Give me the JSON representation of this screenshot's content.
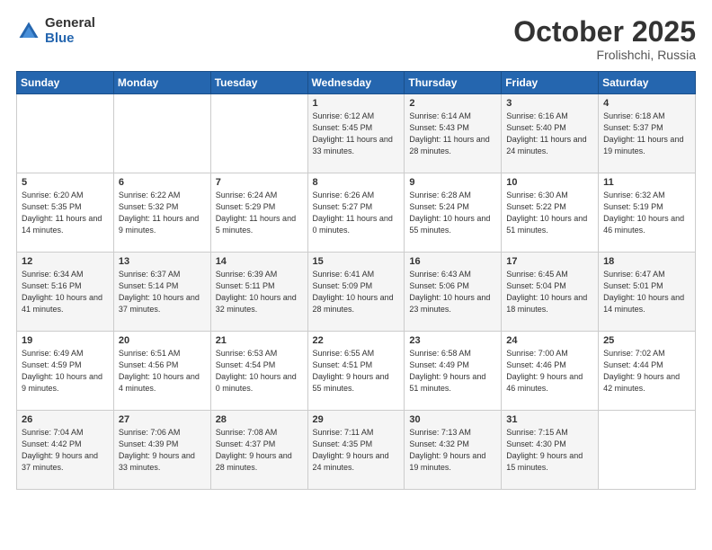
{
  "logo": {
    "general": "General",
    "blue": "Blue"
  },
  "header": {
    "month": "October 2025",
    "location": "Frolishchi, Russia"
  },
  "weekdays": [
    "Sunday",
    "Monday",
    "Tuesday",
    "Wednesday",
    "Thursday",
    "Friday",
    "Saturday"
  ],
  "weeks": [
    [
      {
        "day": "",
        "sunrise": "",
        "sunset": "",
        "daylight": ""
      },
      {
        "day": "",
        "sunrise": "",
        "sunset": "",
        "daylight": ""
      },
      {
        "day": "",
        "sunrise": "",
        "sunset": "",
        "daylight": ""
      },
      {
        "day": "1",
        "sunrise": "Sunrise: 6:12 AM",
        "sunset": "Sunset: 5:45 PM",
        "daylight": "Daylight: 11 hours and 33 minutes."
      },
      {
        "day": "2",
        "sunrise": "Sunrise: 6:14 AM",
        "sunset": "Sunset: 5:43 PM",
        "daylight": "Daylight: 11 hours and 28 minutes."
      },
      {
        "day": "3",
        "sunrise": "Sunrise: 6:16 AM",
        "sunset": "Sunset: 5:40 PM",
        "daylight": "Daylight: 11 hours and 24 minutes."
      },
      {
        "day": "4",
        "sunrise": "Sunrise: 6:18 AM",
        "sunset": "Sunset: 5:37 PM",
        "daylight": "Daylight: 11 hours and 19 minutes."
      }
    ],
    [
      {
        "day": "5",
        "sunrise": "Sunrise: 6:20 AM",
        "sunset": "Sunset: 5:35 PM",
        "daylight": "Daylight: 11 hours and 14 minutes."
      },
      {
        "day": "6",
        "sunrise": "Sunrise: 6:22 AM",
        "sunset": "Sunset: 5:32 PM",
        "daylight": "Daylight: 11 hours and 9 minutes."
      },
      {
        "day": "7",
        "sunrise": "Sunrise: 6:24 AM",
        "sunset": "Sunset: 5:29 PM",
        "daylight": "Daylight: 11 hours and 5 minutes."
      },
      {
        "day": "8",
        "sunrise": "Sunrise: 6:26 AM",
        "sunset": "Sunset: 5:27 PM",
        "daylight": "Daylight: 11 hours and 0 minutes."
      },
      {
        "day": "9",
        "sunrise": "Sunrise: 6:28 AM",
        "sunset": "Sunset: 5:24 PM",
        "daylight": "Daylight: 10 hours and 55 minutes."
      },
      {
        "day": "10",
        "sunrise": "Sunrise: 6:30 AM",
        "sunset": "Sunset: 5:22 PM",
        "daylight": "Daylight: 10 hours and 51 minutes."
      },
      {
        "day": "11",
        "sunrise": "Sunrise: 6:32 AM",
        "sunset": "Sunset: 5:19 PM",
        "daylight": "Daylight: 10 hours and 46 minutes."
      }
    ],
    [
      {
        "day": "12",
        "sunrise": "Sunrise: 6:34 AM",
        "sunset": "Sunset: 5:16 PM",
        "daylight": "Daylight: 10 hours and 41 minutes."
      },
      {
        "day": "13",
        "sunrise": "Sunrise: 6:37 AM",
        "sunset": "Sunset: 5:14 PM",
        "daylight": "Daylight: 10 hours and 37 minutes."
      },
      {
        "day": "14",
        "sunrise": "Sunrise: 6:39 AM",
        "sunset": "Sunset: 5:11 PM",
        "daylight": "Daylight: 10 hours and 32 minutes."
      },
      {
        "day": "15",
        "sunrise": "Sunrise: 6:41 AM",
        "sunset": "Sunset: 5:09 PM",
        "daylight": "Daylight: 10 hours and 28 minutes."
      },
      {
        "day": "16",
        "sunrise": "Sunrise: 6:43 AM",
        "sunset": "Sunset: 5:06 PM",
        "daylight": "Daylight: 10 hours and 23 minutes."
      },
      {
        "day": "17",
        "sunrise": "Sunrise: 6:45 AM",
        "sunset": "Sunset: 5:04 PM",
        "daylight": "Daylight: 10 hours and 18 minutes."
      },
      {
        "day": "18",
        "sunrise": "Sunrise: 6:47 AM",
        "sunset": "Sunset: 5:01 PM",
        "daylight": "Daylight: 10 hours and 14 minutes."
      }
    ],
    [
      {
        "day": "19",
        "sunrise": "Sunrise: 6:49 AM",
        "sunset": "Sunset: 4:59 PM",
        "daylight": "Daylight: 10 hours and 9 minutes."
      },
      {
        "day": "20",
        "sunrise": "Sunrise: 6:51 AM",
        "sunset": "Sunset: 4:56 PM",
        "daylight": "Daylight: 10 hours and 4 minutes."
      },
      {
        "day": "21",
        "sunrise": "Sunrise: 6:53 AM",
        "sunset": "Sunset: 4:54 PM",
        "daylight": "Daylight: 10 hours and 0 minutes."
      },
      {
        "day": "22",
        "sunrise": "Sunrise: 6:55 AM",
        "sunset": "Sunset: 4:51 PM",
        "daylight": "Daylight: 9 hours and 55 minutes."
      },
      {
        "day": "23",
        "sunrise": "Sunrise: 6:58 AM",
        "sunset": "Sunset: 4:49 PM",
        "daylight": "Daylight: 9 hours and 51 minutes."
      },
      {
        "day": "24",
        "sunrise": "Sunrise: 7:00 AM",
        "sunset": "Sunset: 4:46 PM",
        "daylight": "Daylight: 9 hours and 46 minutes."
      },
      {
        "day": "25",
        "sunrise": "Sunrise: 7:02 AM",
        "sunset": "Sunset: 4:44 PM",
        "daylight": "Daylight: 9 hours and 42 minutes."
      }
    ],
    [
      {
        "day": "26",
        "sunrise": "Sunrise: 7:04 AM",
        "sunset": "Sunset: 4:42 PM",
        "daylight": "Daylight: 9 hours and 37 minutes."
      },
      {
        "day": "27",
        "sunrise": "Sunrise: 7:06 AM",
        "sunset": "Sunset: 4:39 PM",
        "daylight": "Daylight: 9 hours and 33 minutes."
      },
      {
        "day": "28",
        "sunrise": "Sunrise: 7:08 AM",
        "sunset": "Sunset: 4:37 PM",
        "daylight": "Daylight: 9 hours and 28 minutes."
      },
      {
        "day": "29",
        "sunrise": "Sunrise: 7:11 AM",
        "sunset": "Sunset: 4:35 PM",
        "daylight": "Daylight: 9 hours and 24 minutes."
      },
      {
        "day": "30",
        "sunrise": "Sunrise: 7:13 AM",
        "sunset": "Sunset: 4:32 PM",
        "daylight": "Daylight: 9 hours and 19 minutes."
      },
      {
        "day": "31",
        "sunrise": "Sunrise: 7:15 AM",
        "sunset": "Sunset: 4:30 PM",
        "daylight": "Daylight: 9 hours and 15 minutes."
      },
      {
        "day": "",
        "sunrise": "",
        "sunset": "",
        "daylight": ""
      }
    ]
  ]
}
